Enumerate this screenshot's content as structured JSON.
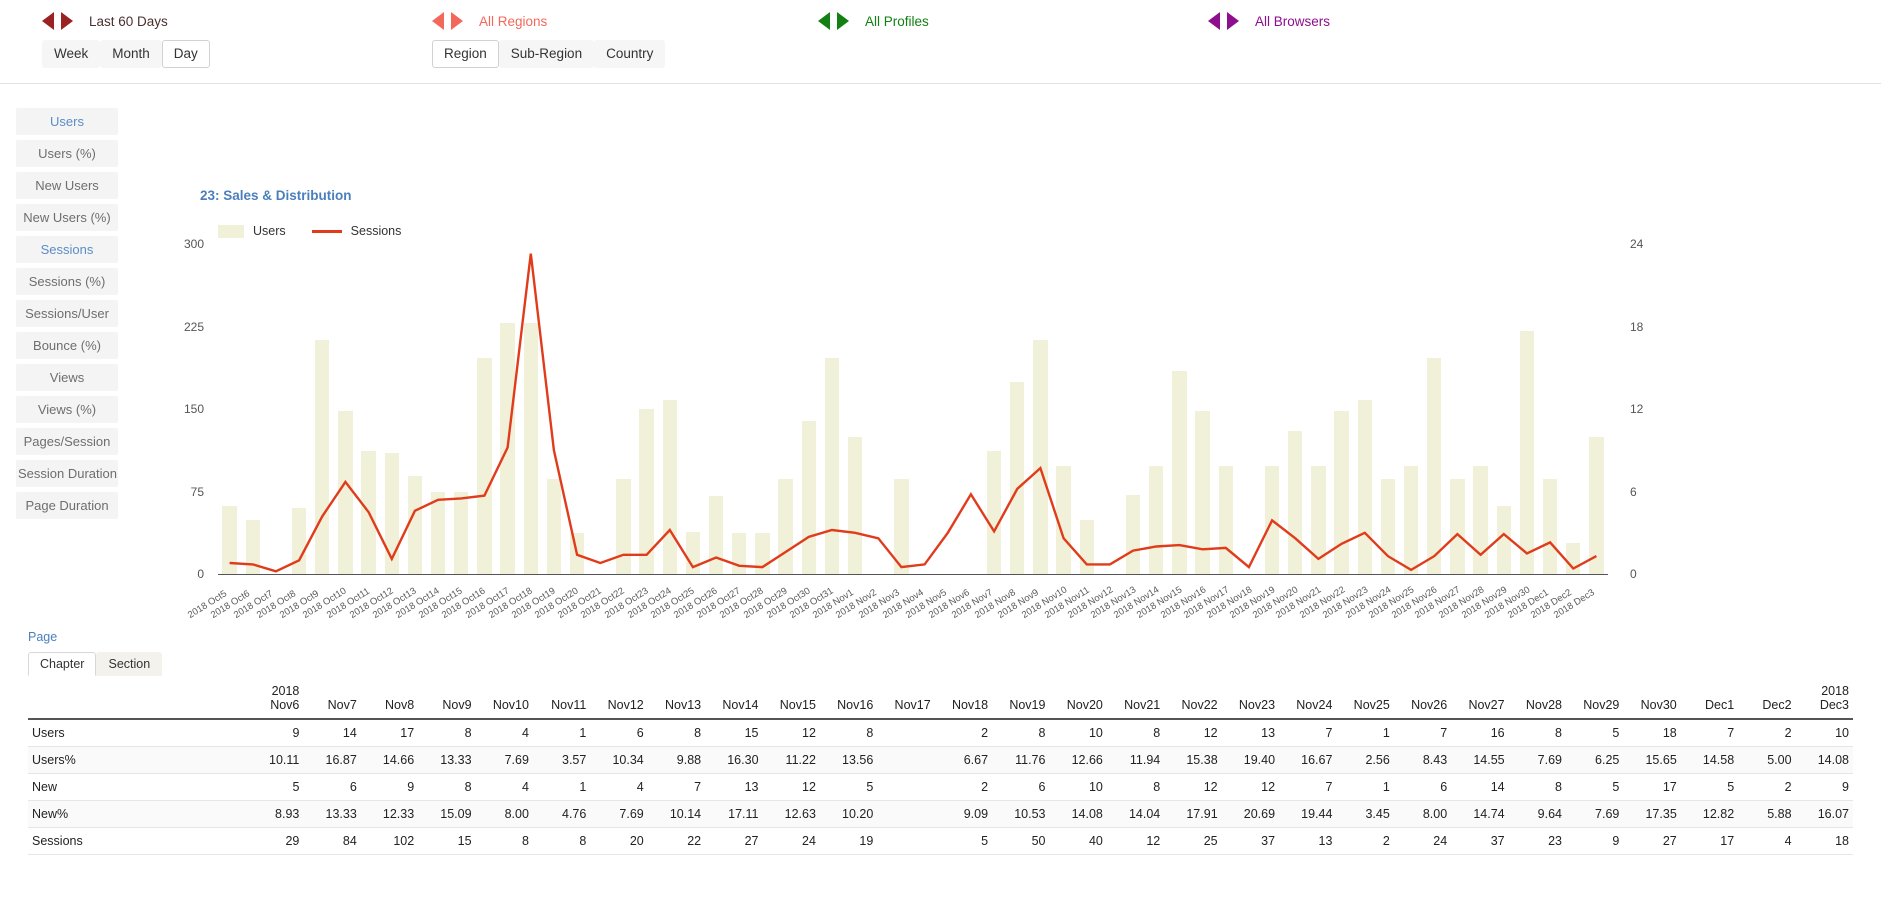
{
  "topbar": {
    "filters": [
      {
        "name": "date-range",
        "label": "Last 60 Days",
        "color": "#9b2222",
        "buttons": [
          {
            "label": "Week",
            "active": false
          },
          {
            "label": "Month",
            "active": false
          },
          {
            "label": "Day",
            "active": true
          }
        ]
      },
      {
        "name": "region",
        "label": "All Regions",
        "color": "#f4685c",
        "buttons": [
          {
            "label": "Region",
            "active": true
          },
          {
            "label": "Sub-Region",
            "active": false
          },
          {
            "label": "Country",
            "active": false
          }
        ]
      },
      {
        "name": "profile",
        "label": "All Profiles",
        "color": "#128012",
        "buttons": []
      },
      {
        "name": "browser",
        "label": "All Browsers",
        "color": "#8e0e8e",
        "buttons": []
      }
    ]
  },
  "sidebar": {
    "items": [
      {
        "label": "Users",
        "active": true
      },
      {
        "label": "Users (%)",
        "active": false
      },
      {
        "label": "New Users",
        "active": false
      },
      {
        "label": "New Users (%)",
        "active": false
      },
      {
        "label": "Sessions",
        "active": true
      },
      {
        "label": "Sessions (%)",
        "active": false
      },
      {
        "label": "Sessions/User",
        "active": false
      },
      {
        "label": "Bounce (%)",
        "active": false
      },
      {
        "label": "Views",
        "active": false
      },
      {
        "label": "Views (%)",
        "active": false
      },
      {
        "label": "Pages/Session",
        "active": false
      },
      {
        "label": "Session Duration",
        "active": false
      },
      {
        "label": "Page Duration",
        "active": false
      }
    ]
  },
  "chart_data": {
    "type": "bar",
    "title": "23: Sales & Distribution",
    "xlabel": "",
    "ylabel": "",
    "grid": false,
    "legend_position": "top-left",
    "legend": [
      {
        "name": "Users",
        "color": "#f1f1d9",
        "mark": "bar"
      },
      {
        "name": "Sessions",
        "color": "#e03c1c",
        "mark": "line"
      }
    ],
    "y_left": {
      "label": "Users",
      "ticks": [
        0,
        75,
        150,
        225,
        300
      ],
      "ylim": [
        0,
        300
      ],
      "color": "#f1f1d9"
    },
    "y_right": {
      "label": "Sessions",
      "ticks": [
        0,
        6,
        12,
        18,
        24
      ],
      "ylim": [
        0,
        24
      ],
      "color": "#e03c1c"
    },
    "categories": [
      "2018 Oct5",
      "2018 Oct6",
      "2018 Oct7",
      "2018 Oct8",
      "2018 Oct9",
      "2018 Oct10",
      "2018 Oct11",
      "2018 Oct12",
      "2018 Oct13",
      "2018 Oct14",
      "2018 Oct15",
      "2018 Oct16",
      "2018 Oct17",
      "2018 Oct18",
      "2018 Oct19",
      "2018 Oct20",
      "2018 Oct21",
      "2018 Oct22",
      "2018 Oct23",
      "2018 Oct24",
      "2018 Oct25",
      "2018 Oct26",
      "2018 Oct27",
      "2018 Oct28",
      "2018 Oct29",
      "2018 Oct30",
      "2018 Oct31",
      "2018 Nov1",
      "2018 Nov2",
      "2018 Nov3",
      "2018 Nov4",
      "2018 Nov5",
      "2018 Nov6",
      "2018 Nov7",
      "2018 Nov8",
      "2018 Nov9",
      "2018 Nov10",
      "2018 Nov11",
      "2018 Nov12",
      "2018 Nov13",
      "2018 Nov14",
      "2018 Nov15",
      "2018 Nov16",
      "2018 Nov17",
      "2018 Nov18",
      "2018 Nov19",
      "2018 Nov20",
      "2018 Nov21",
      "2018 Nov22",
      "2018 Nov23",
      "2018 Nov24",
      "2018 Nov25",
      "2018 Nov26",
      "2018 Nov27",
      "2018 Nov28",
      "2018 Nov29",
      "2018 Nov30",
      "2018 Dec1",
      "2018 Dec2",
      "2018 Dec3"
    ],
    "series": [
      {
        "name": "Users",
        "type": "bar",
        "axis": "left",
        "color": "#f1f1d9",
        "values": [
          62,
          49,
          0,
          60,
          213,
          148,
          112,
          110,
          89,
          75,
          75,
          196,
          228,
          228,
          86,
          37,
          0,
          86,
          150,
          158,
          38,
          71,
          37,
          37,
          86,
          139,
          196,
          125,
          0,
          86,
          0,
          0,
          0,
          112,
          175,
          213,
          98,
          49,
          0,
          72,
          98,
          185,
          148,
          98,
          0,
          98,
          130,
          98,
          148,
          158,
          86,
          98,
          196,
          86,
          98,
          62,
          221,
          86,
          28,
          125
        ]
      },
      {
        "name": "Sessions",
        "type": "line",
        "axis": "right",
        "color": "#e03c1c",
        "values": [
          0.8,
          0.7,
          0.2,
          1.0,
          4.2,
          6.7,
          4.5,
          1.1,
          4.6,
          5.4,
          5.5,
          5.7,
          9.2,
          23.3,
          9.0,
          1.4,
          0.8,
          1.4,
          1.4,
          3.2,
          0.5,
          1.2,
          0.6,
          0.5,
          1.6,
          2.7,
          3.2,
          3.0,
          2.6,
          0.5,
          0.7,
          3.0,
          5.8,
          3.1,
          6.2,
          7.7,
          2.6,
          0.7,
          0.7,
          1.7,
          2.0,
          2.1,
          1.8,
          1.9,
          0.5,
          3.9,
          2.6,
          1.1,
          2.2,
          3.0,
          1.3,
          0.3,
          1.3,
          2.9,
          1.4,
          2.9,
          1.5,
          2.3,
          0.4,
          1.3
        ]
      }
    ]
  },
  "table": {
    "header_label": "Page",
    "tabs": [
      {
        "label": "Chapter",
        "active": true
      },
      {
        "label": "Section",
        "active": false
      }
    ],
    "columns": [
      "2018\nNov6",
      "Nov7",
      "Nov8",
      "Nov9",
      "Nov10",
      "Nov11",
      "Nov12",
      "Nov13",
      "Nov14",
      "Nov15",
      "Nov16",
      "Nov17",
      "Nov18",
      "Nov19",
      "Nov20",
      "Nov21",
      "Nov22",
      "Nov23",
      "Nov24",
      "Nov25",
      "Nov26",
      "Nov27",
      "Nov28",
      "Nov29",
      "Nov30",
      "Dec1",
      "Dec2",
      "2018\nDec3"
    ],
    "rows": [
      {
        "label": "Users",
        "values": [
          "9",
          "14",
          "17",
          "8",
          "4",
          "1",
          "6",
          "8",
          "15",
          "12",
          "8",
          "",
          "2",
          "8",
          "10",
          "8",
          "12",
          "13",
          "7",
          "1",
          "7",
          "16",
          "8",
          "5",
          "18",
          "7",
          "2",
          "10"
        ]
      },
      {
        "label": "Users%",
        "values": [
          "10.11",
          "16.87",
          "14.66",
          "13.33",
          "7.69",
          "3.57",
          "10.34",
          "9.88",
          "16.30",
          "11.22",
          "13.56",
          "",
          "6.67",
          "11.76",
          "12.66",
          "11.94",
          "15.38",
          "19.40",
          "16.67",
          "2.56",
          "8.43",
          "14.55",
          "7.69",
          "6.25",
          "15.65",
          "14.58",
          "5.00",
          "14.08"
        ]
      },
      {
        "label": "New",
        "values": [
          "5",
          "6",
          "9",
          "8",
          "4",
          "1",
          "4",
          "7",
          "13",
          "12",
          "5",
          "",
          "2",
          "6",
          "10",
          "8",
          "12",
          "12",
          "7",
          "1",
          "6",
          "14",
          "8",
          "5",
          "17",
          "5",
          "2",
          "9"
        ]
      },
      {
        "label": "New%",
        "values": [
          "8.93",
          "13.33",
          "12.33",
          "15.09",
          "8.00",
          "4.76",
          "7.69",
          "10.14",
          "17.11",
          "12.63",
          "10.20",
          "",
          "9.09",
          "10.53",
          "14.08",
          "14.04",
          "17.91",
          "20.69",
          "19.44",
          "3.45",
          "8.00",
          "14.74",
          "9.64",
          "7.69",
          "17.35",
          "12.82",
          "5.88",
          "16.07"
        ]
      },
      {
        "label": "Sessions",
        "values": [
          "29",
          "84",
          "102",
          "15",
          "8",
          "8",
          "20",
          "22",
          "27",
          "24",
          "19",
          "",
          "5",
          "50",
          "40",
          "12",
          "25",
          "37",
          "13",
          "2",
          "24",
          "37",
          "23",
          "9",
          "27",
          "17",
          "4",
          "18"
        ]
      }
    ]
  }
}
